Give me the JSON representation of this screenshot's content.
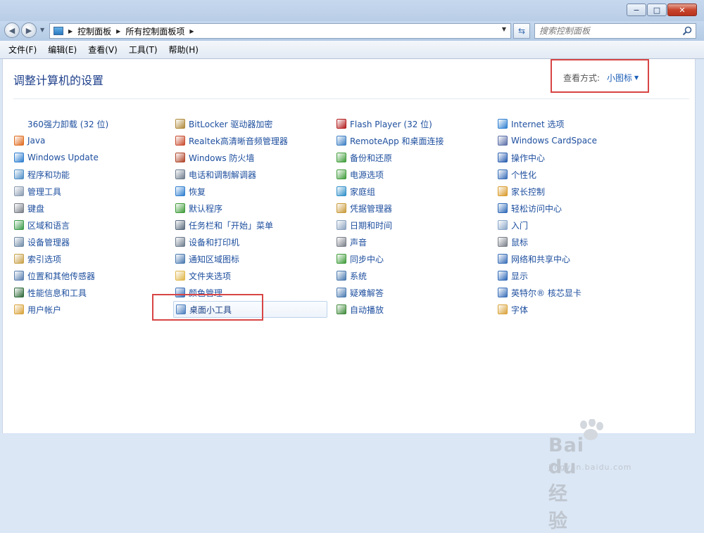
{
  "window": {
    "minimize_label": "−",
    "maximize_label": "□",
    "close_label": "✕"
  },
  "address": {
    "breadcrumbs": [
      "控制面板",
      "所有控制面板项"
    ],
    "search_placeholder": "搜索控制面板"
  },
  "menu": [
    "文件(F)",
    "编辑(E)",
    "查看(V)",
    "工具(T)",
    "帮助(H)"
  ],
  "page": {
    "title": "调整计算机的设置",
    "view_by_label": "查看方式:",
    "view_by_value": "小图标"
  },
  "columns": [
    [
      {
        "label": "360强力卸载 (32 位)",
        "icon": "uninstall-icon",
        "color": "#ffffff"
      },
      {
        "label": "Java",
        "icon": "java-icon",
        "color": "#e06b1f"
      },
      {
        "label": "Windows Update",
        "icon": "windows-update-icon",
        "color": "#2f7fd0"
      },
      {
        "label": "程序和功能",
        "icon": "programs-icon",
        "color": "#4f8fc7"
      },
      {
        "label": "管理工具",
        "icon": "admin-tools-icon",
        "color": "#8a9bb0"
      },
      {
        "label": "键盘",
        "icon": "keyboard-icon",
        "color": "#7a7f88"
      },
      {
        "label": "区域和语言",
        "icon": "globe-icon",
        "color": "#3c9b4a"
      },
      {
        "label": "设备管理器",
        "icon": "device-manager-icon",
        "color": "#6f8aa6"
      },
      {
        "label": "索引选项",
        "icon": "indexing-icon",
        "color": "#c9a24a"
      },
      {
        "label": "位置和其他传感器",
        "icon": "sensor-icon",
        "color": "#5a7fb0"
      },
      {
        "label": "性能信息和工具",
        "icon": "performance-icon",
        "color": "#2f6a3a"
      },
      {
        "label": "用户帐户",
        "icon": "user-accounts-icon",
        "color": "#d9a33a"
      }
    ],
    [
      {
        "label": "BitLocker 驱动器加密",
        "icon": "bitlocker-icon",
        "color": "#b08a3a"
      },
      {
        "label": "Realtek高清晰音频管理器",
        "icon": "realtek-audio-icon",
        "color": "#c94b2e"
      },
      {
        "label": "Windows 防火墙",
        "icon": "firewall-icon",
        "color": "#b0452a"
      },
      {
        "label": "电话和调制解调器",
        "icon": "phone-modem-icon",
        "color": "#6d7b8c"
      },
      {
        "label": "恢复",
        "icon": "recovery-icon",
        "color": "#2f7fd0"
      },
      {
        "label": "默认程序",
        "icon": "default-programs-icon",
        "color": "#3f9c3a"
      },
      {
        "label": "任务栏和「开始」菜单",
        "icon": "taskbar-icon",
        "color": "#5a6b7d"
      },
      {
        "label": "设备和打印机",
        "icon": "printer-icon",
        "color": "#6d7b8c"
      },
      {
        "label": "通知区域图标",
        "icon": "notification-icon",
        "color": "#4a7ab0"
      },
      {
        "label": "文件夹选项",
        "icon": "folder-options-icon",
        "color": "#e0b64a"
      },
      {
        "label": "颜色管理",
        "icon": "color-management-icon",
        "color": "#3a6fb8"
      },
      {
        "label": "桌面小工具",
        "icon": "gadgets-icon",
        "color": "#4a7fc0"
      }
    ],
    [
      {
        "label": "Flash Player (32 位)",
        "icon": "flash-icon",
        "color": "#b31b1b"
      },
      {
        "label": "RemoteApp 和桌面连接",
        "icon": "remoteapp-icon",
        "color": "#3d7fc4"
      },
      {
        "label": "备份和还原",
        "icon": "backup-icon",
        "color": "#3f9c3a"
      },
      {
        "label": "电源选项",
        "icon": "power-icon",
        "color": "#3f9c3a"
      },
      {
        "label": "家庭组",
        "icon": "homegroup-icon",
        "color": "#2f8fc9"
      },
      {
        "label": "凭据管理器",
        "icon": "credential-icon",
        "color": "#c99a3a"
      },
      {
        "label": "日期和时间",
        "icon": "clock-icon",
        "color": "#8ca3c0"
      },
      {
        "label": "声音",
        "icon": "speaker-icon",
        "color": "#7a7f88"
      },
      {
        "label": "同步中心",
        "icon": "sync-icon",
        "color": "#3f9c3a"
      },
      {
        "label": "系统",
        "icon": "system-icon",
        "color": "#4a7ab0"
      },
      {
        "label": "疑难解答",
        "icon": "troubleshoot-icon",
        "color": "#4a7ab0"
      },
      {
        "label": "自动播放",
        "icon": "autoplay-icon",
        "color": "#3f8a3a"
      }
    ],
    [
      {
        "label": "Internet 选项",
        "icon": "internet-options-icon",
        "color": "#2f7fd0"
      },
      {
        "label": "Windows CardSpace",
        "icon": "cardspace-icon",
        "color": "#5b6fa8"
      },
      {
        "label": "操作中心",
        "icon": "action-center-icon",
        "color": "#2b5fb0"
      },
      {
        "label": "个性化",
        "icon": "personalization-icon",
        "color": "#3a6fb8"
      },
      {
        "label": "家长控制",
        "icon": "parental-controls-icon",
        "color": "#d99a2a"
      },
      {
        "label": "轻松访问中心",
        "icon": "ease-of-access-icon",
        "color": "#2f6ab8"
      },
      {
        "label": "入门",
        "icon": "getting-started-icon",
        "color": "#8aa6c8"
      },
      {
        "label": "鼠标",
        "icon": "mouse-icon",
        "color": "#7a7f88"
      },
      {
        "label": "网络和共享中心",
        "icon": "network-icon",
        "color": "#3a6fb8"
      },
      {
        "label": "显示",
        "icon": "display-icon",
        "color": "#2f6ab8"
      },
      {
        "label": "英特尔® 核芯显卡",
        "icon": "intel-graphics-icon",
        "color": "#3a6fb8"
      },
      {
        "label": "字体",
        "icon": "fonts-icon",
        "color": "#d9a33a"
      }
    ]
  ],
  "selected_item": "桌面小工具",
  "watermark": {
    "brand": "Bai du经验",
    "sub": "jingyan.baidu.com"
  }
}
